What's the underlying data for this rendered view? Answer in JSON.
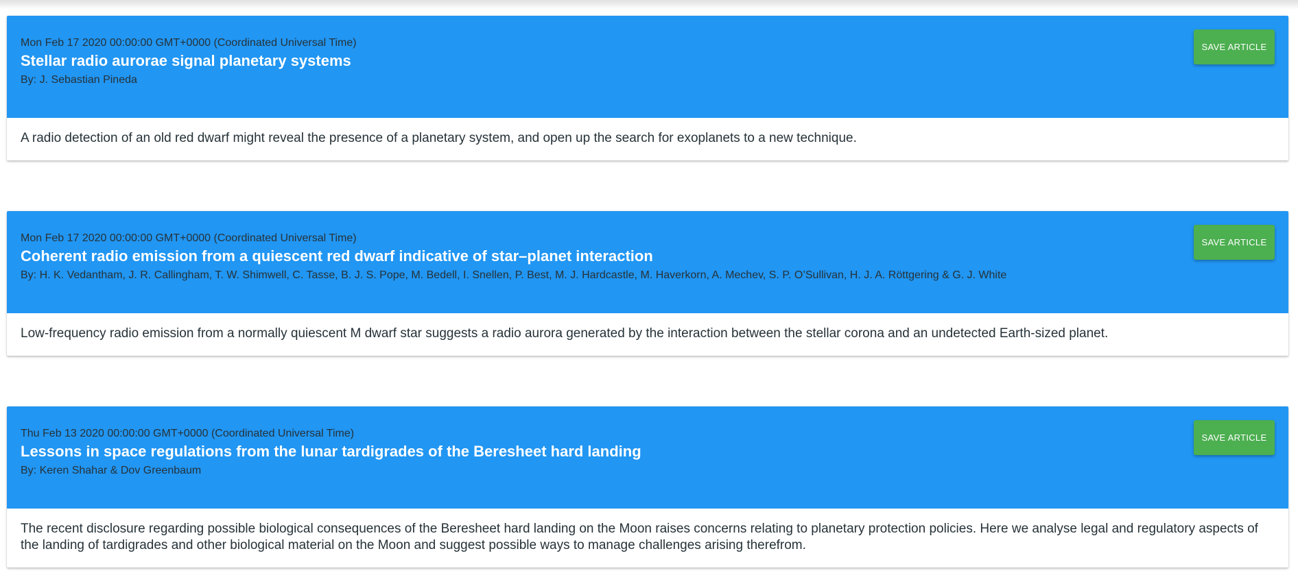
{
  "articles": [
    {
      "date": "Mon Feb 17 2020 00:00:00 GMT+0000 (Coordinated Universal Time)",
      "title": "Stellar radio aurorae signal planetary systems",
      "authors": "By: J. Sebastian Pineda",
      "summary": "A radio detection of an old red dwarf might reveal the presence of a planetary system, and open up the search for exoplanets to a new technique.",
      "save_label": "SAVE ARTICLE"
    },
    {
      "date": "Mon Feb 17 2020 00:00:00 GMT+0000 (Coordinated Universal Time)",
      "title": "Coherent radio emission from a quiescent red dwarf indicative of star–planet interaction",
      "authors": "By: H. K. Vedantham, J. R. Callingham, T. W. Shimwell, C. Tasse, B. J. S. Pope, M. Bedell, I. Snellen, P. Best, M. J. Hardcastle, M. Haverkorn, A. Mechev, S. P. O’Sullivan, H. J. A. Röttgering & G. J. White",
      "summary": "Low-frequency radio emission from a normally quiescent M dwarf star suggests a radio aurora generated by the interaction between the stellar corona and an undetected Earth-sized planet.",
      "save_label": "SAVE ARTICLE"
    },
    {
      "date": "Thu Feb 13 2020 00:00:00 GMT+0000 (Coordinated Universal Time)",
      "title": "Lessons in space regulations from the lunar tardigrades of the Beresheet hard landing",
      "authors": "By: Keren Shahar & Dov Greenbaum",
      "summary": "The recent disclosure regarding possible biological consequences of the Beresheet hard landing on the Moon raises concerns relating to planetary protection policies. Here we analyse legal and regulatory aspects of the landing of tardigrades and other biological material on the Moon and suggest possible ways to manage challenges arising therefrom.",
      "save_label": "SAVE ARTICLE"
    }
  ],
  "colors": {
    "header": "#2196f3",
    "button": "#4caf50",
    "text": "#263238"
  }
}
